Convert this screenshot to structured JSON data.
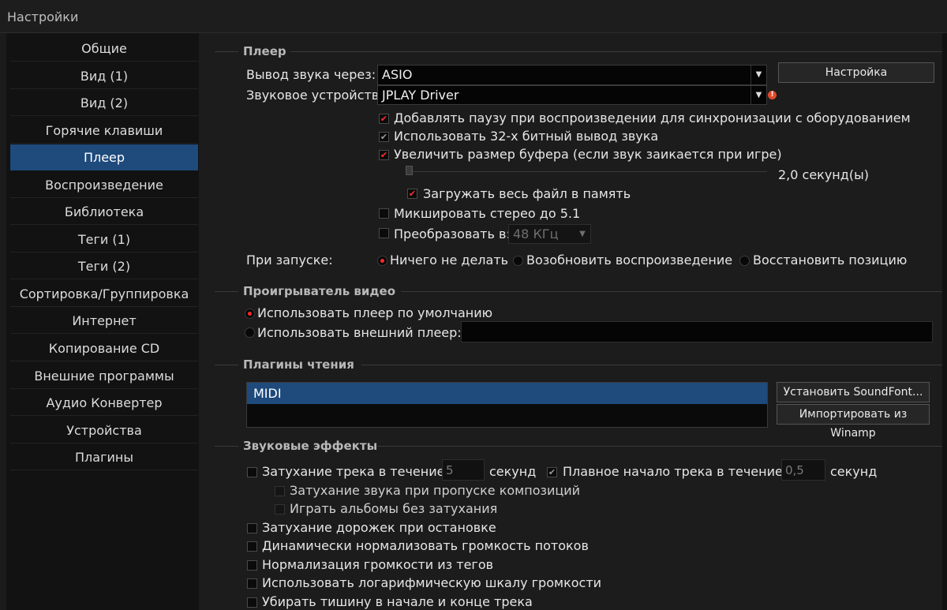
{
  "window": {
    "title": "Настройки"
  },
  "sidebar": {
    "items": [
      {
        "label": "Общие"
      },
      {
        "label": "Вид (1)"
      },
      {
        "label": "Вид (2)"
      },
      {
        "label": "Горячие клавиши"
      },
      {
        "label": "Плеер",
        "active": true
      },
      {
        "label": "Воспроизведение"
      },
      {
        "label": "Библиотека"
      },
      {
        "label": "Теги (1)"
      },
      {
        "label": "Теги (2)"
      },
      {
        "label": "Сортировка/Группировка"
      },
      {
        "label": "Интернет"
      },
      {
        "label": "Копирование CD"
      },
      {
        "label": "Внешние программы"
      },
      {
        "label": "Аудио Конвертер"
      },
      {
        "label": "Устройства"
      },
      {
        "label": "Плагины"
      }
    ]
  },
  "player": {
    "section_title": "Плеер",
    "output_label": "Вывод звука через:",
    "output_value": "ASIO",
    "settings_button": "Настройка",
    "device_label": "Звуковое устройство:",
    "device_value": "JPLAY Driver",
    "opt_pause": "Добавлять паузу при воспроизведении для синхронизации с оборудованием",
    "opt_pause_checked": true,
    "opt_32bit": "Использовать 32-х битный вывод звука",
    "opt_32bit_checked": true,
    "opt_buffer": "Увеличить размер буфера (если звук заикается при игре)",
    "opt_buffer_checked": true,
    "buffer_value_text": "2,0 секунд(ы)",
    "opt_load_file": "Загружать весь файл в память",
    "opt_load_file_checked": true,
    "opt_mix": "Микшировать стерео до 5.1",
    "opt_mix_checked": false,
    "opt_convert": "Преобразовать в:",
    "opt_convert_checked": false,
    "convert_value": "48 КГц",
    "startup_label": "При запуске:",
    "startup_options": [
      "Ничего не делать",
      "Возобновить воспроизведение",
      "Восстановить позицию"
    ],
    "startup_selected": 0
  },
  "video": {
    "section_title": "Проигрыватель видео",
    "opt_default": "Использовать плеер по умолчанию",
    "opt_external": "Использовать внешний плеер:",
    "external_path": ""
  },
  "plugins": {
    "section_title": "Плагины чтения",
    "items": [
      "MIDI"
    ],
    "soundfont_button": "Установить SoundFont...",
    "winamp_button": "Импортировать из Winamp"
  },
  "effects": {
    "section_title": "Звуковые эффекты",
    "fade_track_label": "Затухание трека в течение:",
    "fade_track_value": "5",
    "fade_track_unit": "секунд",
    "smooth_start_label": "Плавное начало трека в течение:",
    "smooth_start_value": "0,5",
    "smooth_start_unit": "секунд",
    "fade_skip": "Затухание звука при пропуске композиций",
    "play_albums": "Играть альбомы без затухания",
    "fade_stop": "Затухание дорожек при остановке",
    "normalize_dynamic": "Динамически нормализовать громкость потоков",
    "normalize_tags": "Нормализация громкости из тегов",
    "log_scale": "Использовать логарифмическую шкалу громкости",
    "remove_silence": "Убирать тишину в начале и конце трека"
  }
}
